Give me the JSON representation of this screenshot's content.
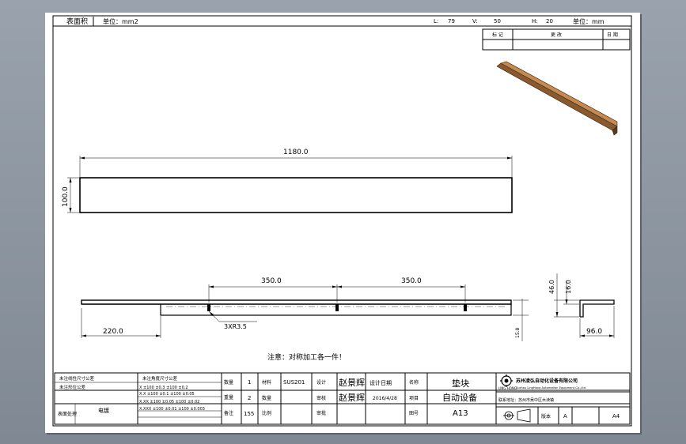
{
  "header": {
    "area_label": "表面积",
    "unit_label_left": "单位：mm2",
    "l_label": "L:",
    "l_value": "79",
    "v_label": "V:",
    "v_value": "50",
    "h_label": "H:",
    "h_value": "20",
    "unit_label_right": "单位：mm"
  },
  "revision_table": {
    "col1": "标 记",
    "col2": "更 改",
    "col3": "日 期"
  },
  "dimensions": {
    "top_length": "1180.0",
    "top_height": "100.0",
    "spacing_left": "350.0",
    "spacing_right": "350.0",
    "left_offset": "220.0",
    "hole_note": "3XR3.5",
    "right_height_46": "46.0",
    "right_height_16": "16.0",
    "side_width": "96.0",
    "thickness_small": "15.8"
  },
  "note": "注意：对称加工各一件！",
  "title_block": {
    "left_rows": [
      {
        "a": "未注线性尺寸公差",
        "b": "未注角度尺寸公差"
      },
      {
        "a": "未注形位公差",
        "b": "X   ±100 ±0.3 ±100 ±0.2"
      },
      {
        "a": "",
        "b": "X.X  ±100 ±0.1 ±100 ±0.05"
      },
      {
        "a": "",
        "b": "X.XX ±100 ±0.05 ±100 ±0.02"
      },
      {
        "a": "",
        "b": "X.XXX ±100 ±0.01 ±100 ±0.003"
      }
    ],
    "surface_label": "表面处理",
    "surface_value": "电镀",
    "row_labels": [
      "数量",
      "重量",
      "备注"
    ],
    "row_values": [
      "1",
      "2",
      "155"
    ],
    "col2_labels": [
      "材料",
      "数量",
      "比例"
    ],
    "material": "SUS201",
    "design_label": "设计",
    "check_label": "审核",
    "approve_label": "审批",
    "designer": "赵景辉",
    "checker": "赵景辉",
    "design_date_label": "设计日期",
    "design_date": "2016/4/28",
    "name_label": "名称",
    "part_name": "垫块",
    "project_label": "项目",
    "project_name": "自动设备",
    "drawing_no_label": "图号",
    "drawing_no": "A13",
    "company_cn": "苏州凌弘自动化设备有限公司",
    "company_en": "Suzhou LingHong Automation Equipment Co.,Ltd.",
    "logo_text": "LING HONG",
    "address": "联系地址：苏州市吴中区木渎镇",
    "version_label": "版本",
    "version": "A",
    "size_label": "A4"
  }
}
